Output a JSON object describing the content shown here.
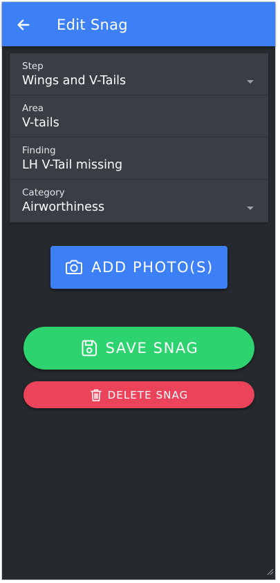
{
  "header": {
    "title": "Edit Snag",
    "back_icon": "arrow-left-icon",
    "color": "#3d80f5"
  },
  "form": {
    "fields": [
      {
        "label": "Step",
        "value": "Wings and V-Tails",
        "dropdown": true
      },
      {
        "label": "Area",
        "value": "V-tails",
        "dropdown": false
      },
      {
        "label": "Finding",
        "value": "LH V-Tail missing",
        "dropdown": false
      },
      {
        "label": "Category",
        "value": "Airworthiness",
        "dropdown": true
      }
    ]
  },
  "actions": {
    "add_photo": {
      "label": "ADD PHOTO(S)",
      "icon": "camera-icon",
      "color": "#3d80f5"
    },
    "save": {
      "label": "SAVE SNAG",
      "icon": "floppy-disk-icon",
      "color": "#2dd36f"
    },
    "delete": {
      "label": "DELETE SNAG",
      "icon": "trash-icon",
      "color": "#eb445a"
    }
  },
  "theme": {
    "background": "#262a2e",
    "field_background": "#383e44"
  }
}
